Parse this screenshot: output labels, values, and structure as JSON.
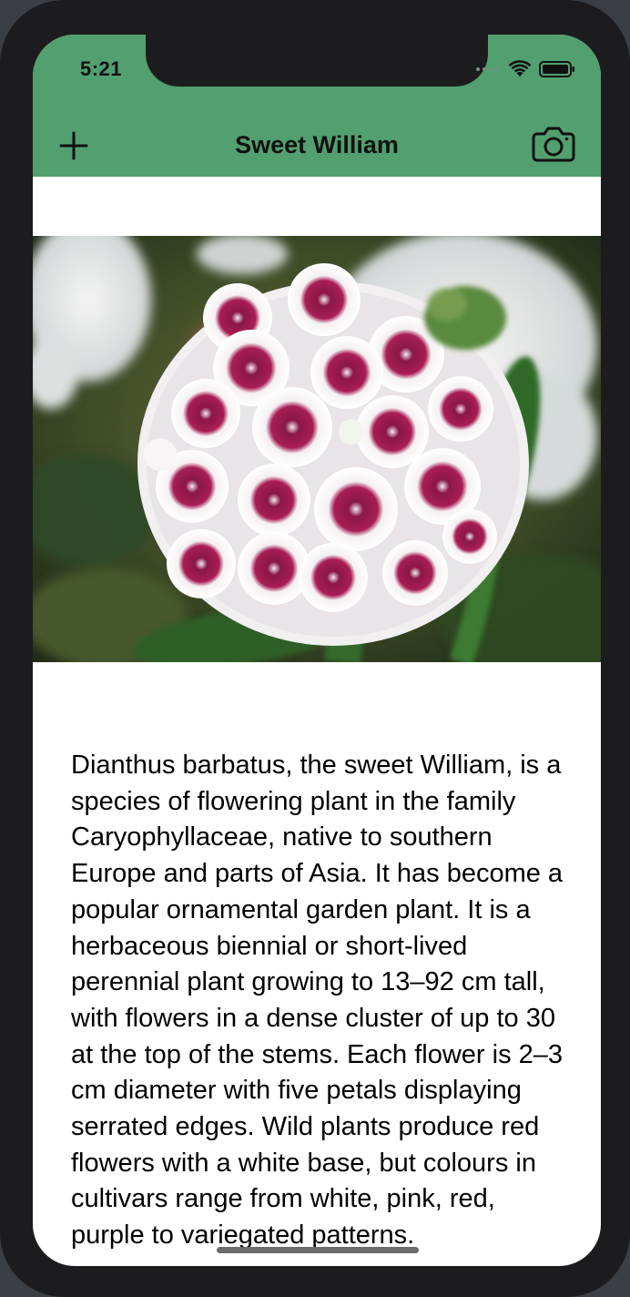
{
  "status_bar": {
    "time": "5:21"
  },
  "nav": {
    "title": "Sweet William",
    "add_icon": "plus-icon",
    "camera_icon": "camera-icon"
  },
  "colors": {
    "header": "#52a070",
    "frame": "#1c1c1e",
    "petal_accent": "#9c1847"
  },
  "plant": {
    "description": "Dianthus barbatus, the sweet William, is a species of flowering plant in the family Caryophyllaceae, native to southern Europe and parts of Asia. It has become a popular ornamental garden plant. It is a herbaceous biennial or short-lived perennial plant growing to 13–92 cm tall, with flowers in a dense cluster of up to 30 at the top of the stems. Each flower is 2–3 cm diameter with five petals displaying serrated edges. Wild plants produce red flowers with a white base, but colours in cultivars range from white, pink, red, purple to variegated patterns."
  }
}
